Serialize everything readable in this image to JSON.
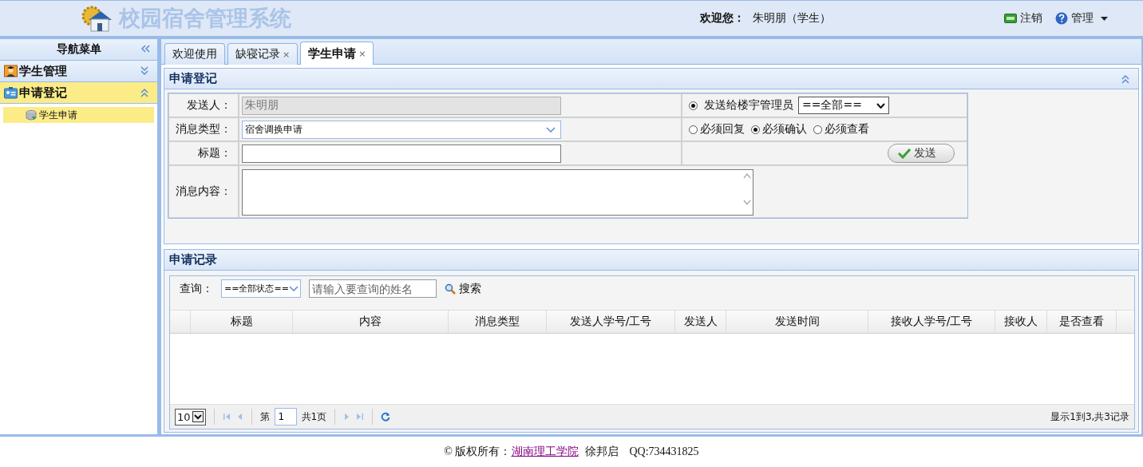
{
  "header": {
    "title": "校园宿舍管理系统",
    "welcome_label": "欢迎您：",
    "user": "朱明朋（学生）",
    "actions": [
      {
        "kind": "logout",
        "label": "注销"
      },
      {
        "kind": "manage",
        "label": "管理"
      }
    ]
  },
  "sidebar": {
    "title": "导航菜单",
    "groups": [
      {
        "kind": "student",
        "label": "学生管理",
        "expanded": false
      },
      {
        "kind": "apply",
        "label": "申请登记",
        "expanded": true,
        "children": [
          {
            "label": "学生申请",
            "selected": true
          }
        ]
      }
    ]
  },
  "tabs": [
    {
      "label": "欢迎使用",
      "selected": false
    },
    {
      "label": "缺寝记录",
      "close": "×",
      "selected": false
    },
    {
      "label": "学生申请",
      "close": "×",
      "selected": true
    }
  ],
  "form": {
    "title": "申请登记",
    "fields": [
      {
        "kind": "text",
        "label": "发送人：",
        "value": "朱明朋",
        "disabled": true
      },
      {
        "kind": "select",
        "label": "消息类型：",
        "value": "宿舍调换申请"
      },
      {
        "kind": "text",
        "label": "标题：",
        "disabled": false
      },
      {
        "kind": "textarea",
        "label": "消息内容："
      }
    ],
    "recipient": {
      "label": "发送给楼宇管理员",
      "selected": true,
      "select_value": "==全部=="
    },
    "options": [
      {
        "label": "必须回复",
        "selected": false
      },
      {
        "label": "必须确认",
        "selected": true
      },
      {
        "label": "必须查看",
        "selected": false
      }
    ],
    "send_button": "发送"
  },
  "records": {
    "title": "申请记录",
    "query_label": "查询：",
    "status_filter": "==全部状态==",
    "search": {
      "placeholder": "请输入要查询的姓名"
    },
    "search_button": "搜索",
    "columns": [
      "标题",
      "内容",
      "消息类型",
      "发送人学号/工号",
      "发送人",
      "发送时间",
      "接收人学号/工号",
      "接收人",
      "是否查看"
    ],
    "pager": {
      "page_size": "10",
      "page_label": "第",
      "page": "1",
      "total_pages": "共1页",
      "summary": "显示1到3,共3记录"
    }
  },
  "footer": {
    "copyright": "© 版权所有：",
    "link": "湖南理工学院",
    "author": "徐邦启",
    "qq": "QQ:734431825"
  }
}
